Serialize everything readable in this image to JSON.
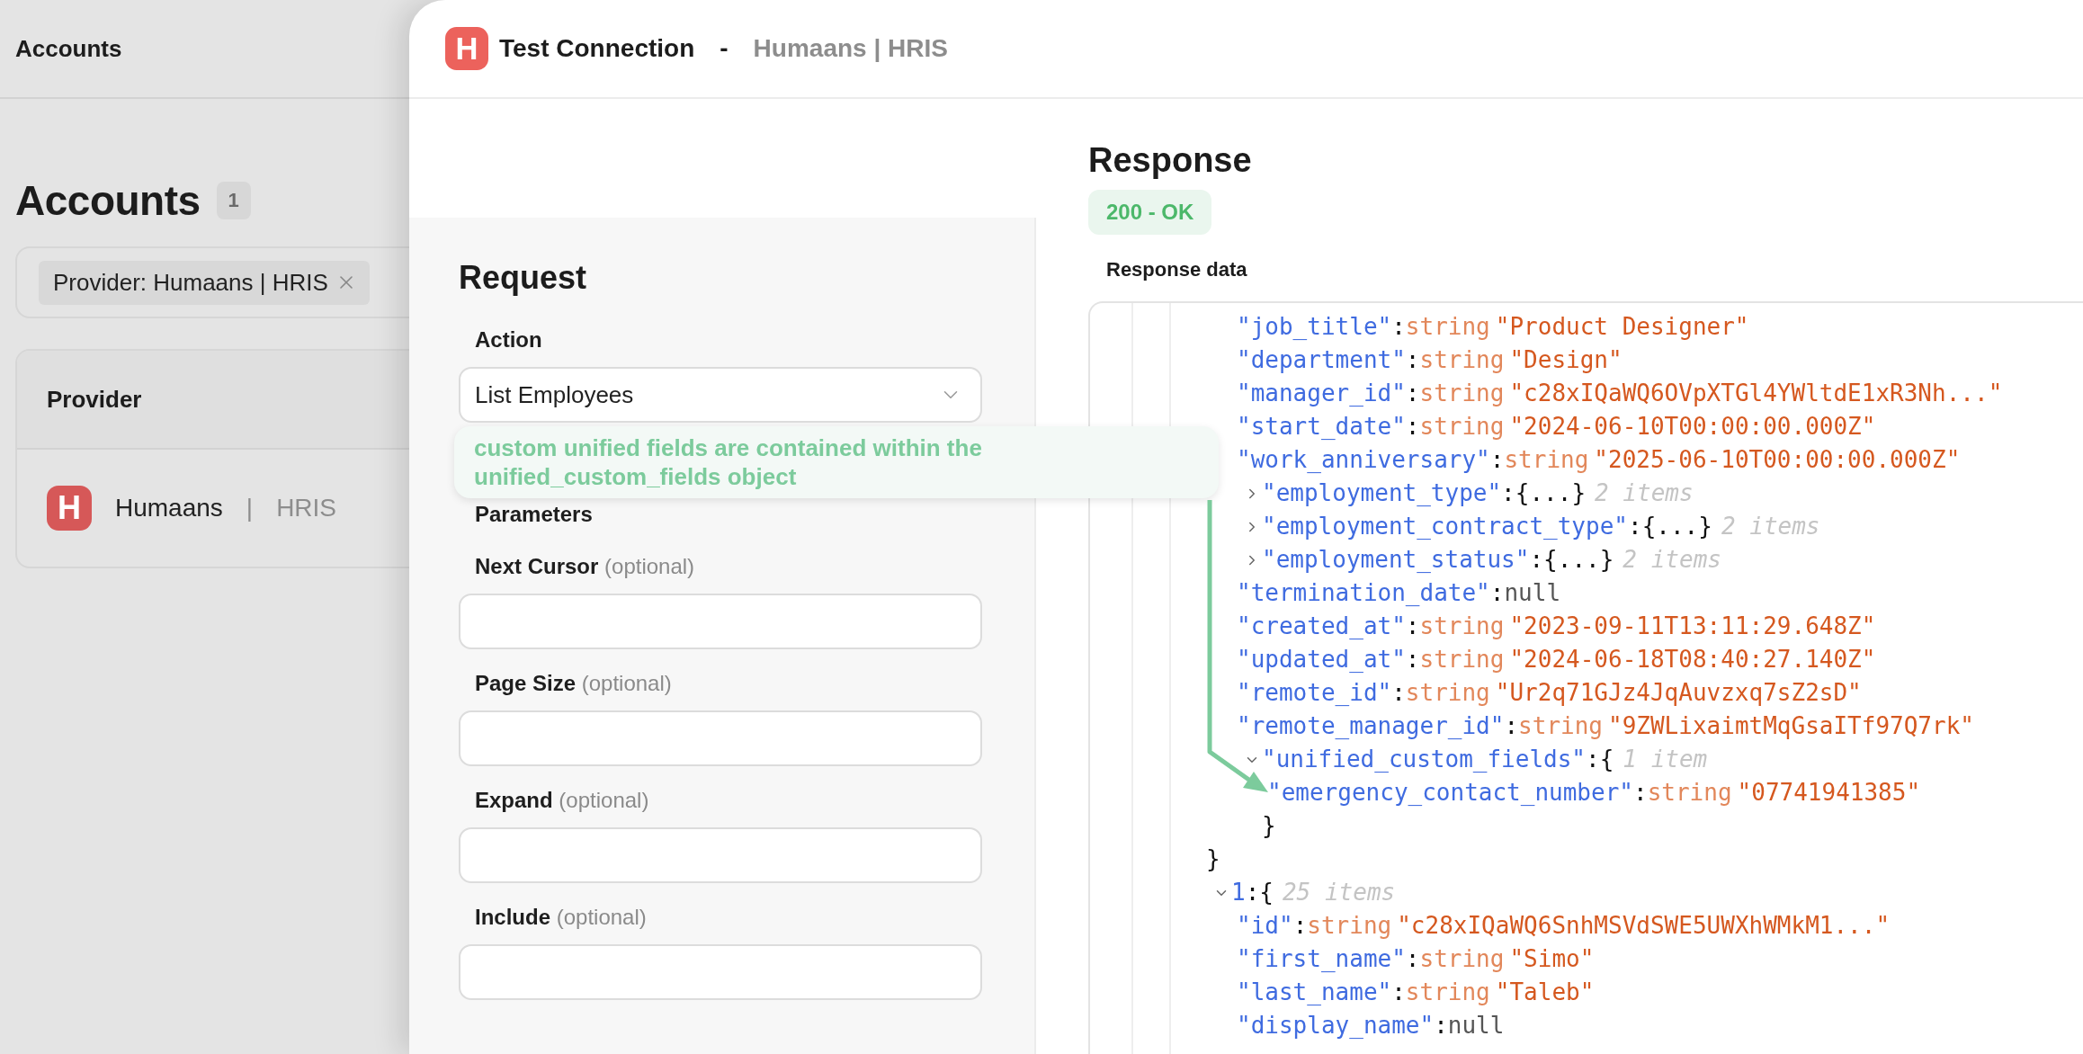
{
  "backdrop": {
    "topbar_title": "Accounts",
    "heading": "Accounts",
    "count": "1",
    "filter_chip": "Provider: Humaans | HRIS",
    "table": {
      "columns": [
        "Provider"
      ],
      "rows": [
        {
          "logo": "H",
          "name": "Humaans",
          "separator": "|",
          "category": "HRIS"
        }
      ]
    }
  },
  "sheet": {
    "logo": "H",
    "title": "Test Connection",
    "separator": "-",
    "subtitle": "Humaans | HRIS"
  },
  "request": {
    "title": "Request",
    "action": {
      "label": "Action",
      "value": "List Employees"
    },
    "parameters_title": "Parameters",
    "parameters": [
      {
        "label": "Next Cursor",
        "hint": "(optional)"
      },
      {
        "label": "Page Size",
        "hint": "(optional)"
      },
      {
        "label": "Expand",
        "hint": "(optional)"
      },
      {
        "label": "Include",
        "hint": "(optional)"
      }
    ]
  },
  "response": {
    "title": "Response",
    "status": "200 - OK",
    "data_label": "Response data",
    "tree": [
      {
        "kind": "group",
        "close": "}",
        "children": [
          {
            "kind": "pair",
            "key": "\"job_title\"",
            "colon": ":",
            "type": "string",
            "value": "\"Product Designer\""
          },
          {
            "kind": "pair",
            "key": "\"department\"",
            "colon": ":",
            "type": "string",
            "value": "\"Design\""
          },
          {
            "kind": "pair",
            "key": "\"manager_id\"",
            "colon": ":",
            "type": "string",
            "value": "\"c28xIQaWQ6OVpXTGl4YWltdE1xR3Nh...\""
          },
          {
            "kind": "pair",
            "key": "\"start_date\"",
            "colon": ":",
            "type": "string",
            "value": "\"2024-06-10T00:00:00.000Z\""
          },
          {
            "kind": "pair",
            "key": "\"work_anniversary\"",
            "colon": ":",
            "type": "string",
            "value": "\"2025-06-10T00:00:00.000Z\""
          },
          {
            "kind": "object",
            "expanded": false,
            "key": "\"employment_type\"",
            "colon": ":",
            "brace": "{...}",
            "count": "2 items"
          },
          {
            "kind": "object",
            "expanded": false,
            "key": "\"employment_contract_type\"",
            "colon": ":",
            "brace": "{...}",
            "count": "2 items"
          },
          {
            "kind": "object",
            "expanded": false,
            "key": "\"employment_status\"",
            "colon": ":",
            "brace": "{...}",
            "count": "2 items"
          },
          {
            "kind": "null",
            "key": "\"termination_date\"",
            "colon": ":",
            "value": "null"
          },
          {
            "kind": "pair",
            "key": "\"created_at\"",
            "colon": ":",
            "type": "string",
            "value": "\"2023-09-11T13:11:29.648Z\""
          },
          {
            "kind": "pair",
            "key": "\"updated_at\"",
            "colon": ":",
            "type": "string",
            "value": "\"2024-06-18T08:40:27.140Z\""
          },
          {
            "kind": "pair",
            "key": "\"remote_id\"",
            "colon": ":",
            "type": "string",
            "value": "\"Ur2q71GJz4JqAuvzxq7sZ2sD\""
          },
          {
            "kind": "pair",
            "key": "\"remote_manager_id\"",
            "colon": ":",
            "type": "string",
            "value": "\"9ZWLixaimtMqGsaITf97Q7rk\""
          },
          {
            "kind": "object",
            "expanded": true,
            "key": "\"unified_custom_fields\"",
            "colon": ":",
            "brace": "{",
            "count": "1 item",
            "close": "}",
            "children": [
              {
                "kind": "pair",
                "key": "\"emergency_contact_number\"",
                "colon": ":",
                "type": "string",
                "value": "\"07741941385\""
              }
            ]
          }
        ]
      },
      {
        "kind": "object",
        "expanded": true,
        "key": "1",
        "colon": ":",
        "brace": "{",
        "count": "25 items",
        "children": [
          {
            "kind": "pair",
            "key": "\"id\"",
            "colon": ":",
            "type": "string",
            "value": "\"c28xIQaWQ6SnhMSVdSWE5UWXhWMkM1...\""
          },
          {
            "kind": "pair",
            "key": "\"first_name\"",
            "colon": ":",
            "type": "string",
            "value": "\"Simo\""
          },
          {
            "kind": "pair",
            "key": "\"last_name\"",
            "colon": ":",
            "type": "string",
            "value": "\"Taleb\""
          },
          {
            "kind": "null",
            "key": "\"display_name\"",
            "colon": ":",
            "value": "null"
          }
        ]
      }
    ]
  },
  "callout": {
    "text": "custom unified fields are contained within the unified_custom_fields object"
  }
}
